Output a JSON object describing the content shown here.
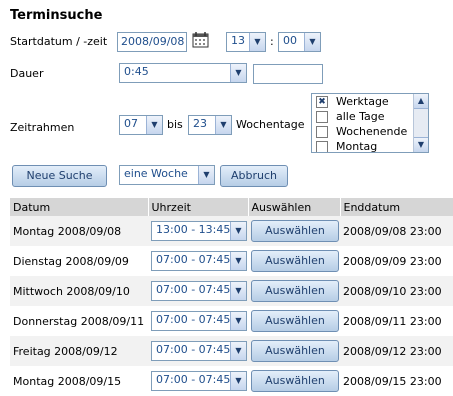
{
  "title": "Terminsuche",
  "start": {
    "label": "Startdatum / -zeit",
    "date_value": "2008/09/08",
    "hour": "13",
    "separator": ":",
    "minute": "00"
  },
  "dauer": {
    "label": "Dauer",
    "value": "0:45",
    "extra_value": ""
  },
  "zeitrahmen": {
    "label": "Zeitrahmen",
    "from": "07",
    "bis_label": "bis",
    "to": "23",
    "wochentage_label": "Wochentage",
    "options": [
      {
        "label": "Werktage",
        "checked": true
      },
      {
        "label": "alle Tage",
        "checked": false
      },
      {
        "label": "Wochenende",
        "checked": false
      },
      {
        "label": "Montag",
        "checked": false
      }
    ]
  },
  "actions": {
    "new_search": "Neue Suche",
    "period": "eine Woche",
    "abort": "Abbruch"
  },
  "table": {
    "headers": [
      "Datum",
      "Uhrzeit",
      "Auswählen",
      "Enddatum"
    ],
    "rows": [
      {
        "datum": "Montag 2008/09/08",
        "uhrzeit": "13:00 - 13:45",
        "button": "Auswählen",
        "enddatum": "2008/09/08 23:00"
      },
      {
        "datum": "Dienstag 2008/09/09",
        "uhrzeit": "07:00 - 07:45",
        "button": "Auswählen",
        "enddatum": "2008/09/09 23:00"
      },
      {
        "datum": "Mittwoch 2008/09/10",
        "uhrzeit": "07:00 - 07:45",
        "button": "Auswählen",
        "enddatum": "2008/09/10 23:00"
      },
      {
        "datum": "Donnerstag 2008/09/11",
        "uhrzeit": "07:00 - 07:45",
        "button": "Auswählen",
        "enddatum": "2008/09/11 23:00"
      },
      {
        "datum": "Freitag 2008/09/12",
        "uhrzeit": "07:00 - 07:45",
        "button": "Auswählen",
        "enddatum": "2008/09/12 23:00"
      },
      {
        "datum": "Montag 2008/09/15",
        "uhrzeit": "07:00 - 07:45",
        "button": "Auswählen",
        "enddatum": "2008/09/15 23:00"
      }
    ]
  }
}
